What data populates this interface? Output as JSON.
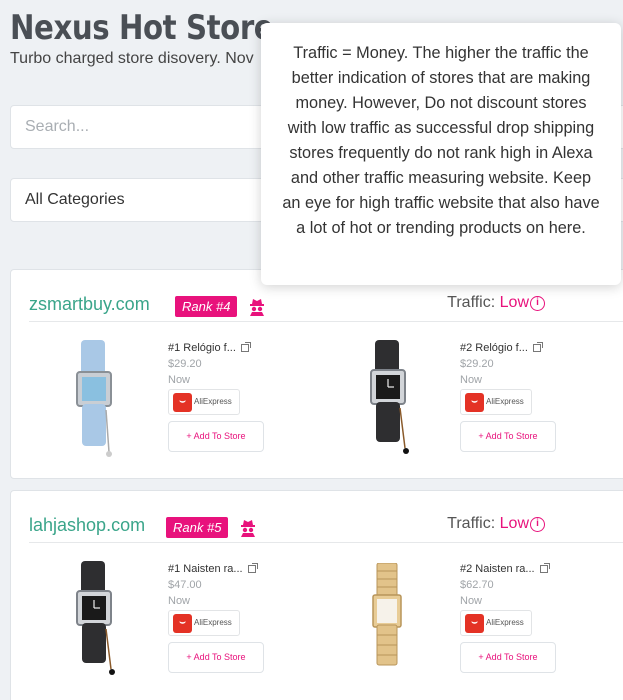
{
  "header": {
    "title": "Nexus Hot Store",
    "subtitle": "Turbo charged store disovery. Nov"
  },
  "search": {
    "placeholder": "Search..."
  },
  "filter": {
    "category": "All Categories"
  },
  "tooltip": {
    "text": "Traffic = Money. The higher the traffic the better indication of stores that are making money. However, Do not discount stores with low traffic as successful drop shipping stores frequently do not rank high in Alexa and other traffic measuring website. Keep an eye for high traffic website that also have a lot of hot or trending products on here."
  },
  "colors": {
    "accent": "#e8127c",
    "store_link": "#3aa58a",
    "aliexpress": "#e43225"
  },
  "stores": [
    {
      "name": "zsmartbuy.com",
      "rank": "Rank #4",
      "traffic_label": "Traffic:",
      "traffic_value": "Low",
      "products": [
        {
          "title": "#1 Relógio f...",
          "price": "$29.20",
          "status": "Now",
          "source": "AliExpress",
          "button": "+ Add To Store",
          "image": "watch-light-blue"
        },
        {
          "title": "#2 Relógio f...",
          "price": "$29.20",
          "status": "Now",
          "source": "AliExpress",
          "button": "+ Add To Store",
          "image": "watch-black"
        }
      ]
    },
    {
      "name": "lahjashop.com",
      "rank": "Rank #5",
      "traffic_label": "Traffic:",
      "traffic_value": "Low",
      "products": [
        {
          "title": "#1 Naisten ra...",
          "price": "$47.00",
          "status": "Now",
          "source": "AliExpress",
          "button": "+ Add To Store",
          "image": "watch-black"
        },
        {
          "title": "#2 Naisten ra...",
          "price": "$62.70",
          "status": "Now",
          "source": "AliExpress",
          "button": "+ Add To Store",
          "image": "watch-gold"
        }
      ]
    }
  ]
}
